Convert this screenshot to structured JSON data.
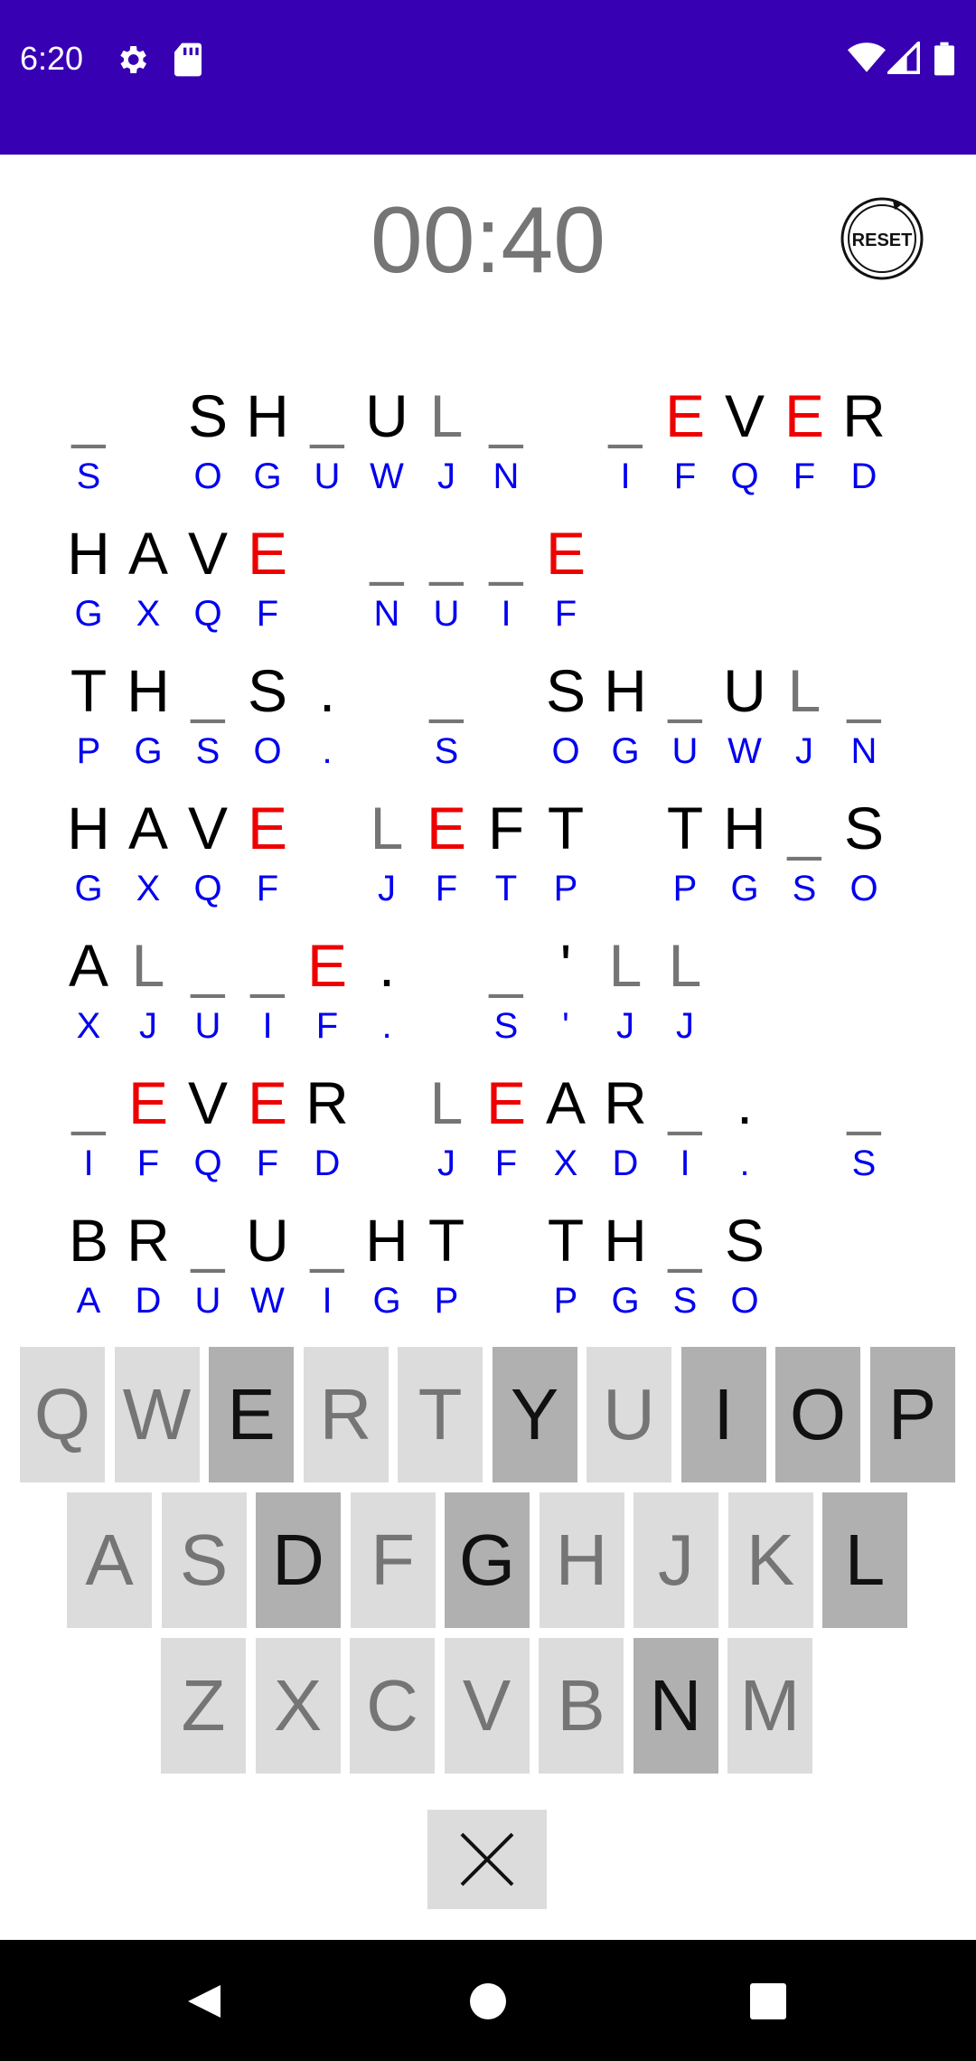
{
  "status_bar": {
    "time": "6:20",
    "left_icons": [
      "gear-icon",
      "sd-card-icon"
    ],
    "right_icons": [
      "wifi-icon",
      "signal-icon",
      "battery-icon"
    ]
  },
  "header": {
    "timer": "00:40",
    "reset_label": "RESET"
  },
  "puzzle": {
    "rows": [
      [
        {
          "col": 0,
          "top": "_",
          "bot": "S"
        },
        {
          "col": 2,
          "top": "S",
          "bot": "O"
        },
        {
          "col": 3,
          "top": "H",
          "bot": "G"
        },
        {
          "col": 4,
          "top": "_",
          "bot": "U"
        },
        {
          "col": 5,
          "top": "U",
          "bot": "W"
        },
        {
          "col": 6,
          "top": "L",
          "bot": "J",
          "state": "guess"
        },
        {
          "col": 7,
          "top": "_",
          "bot": "N"
        },
        {
          "col": 9,
          "top": "_",
          "bot": "I"
        },
        {
          "col": 10,
          "top": "E",
          "bot": "F",
          "state": "hint"
        },
        {
          "col": 11,
          "top": "V",
          "bot": "Q"
        },
        {
          "col": 12,
          "top": "E",
          "bot": "F",
          "state": "hint"
        },
        {
          "col": 13,
          "top": "R",
          "bot": "D"
        }
      ],
      [
        {
          "col": 0,
          "top": "H",
          "bot": "G"
        },
        {
          "col": 1,
          "top": "A",
          "bot": "X"
        },
        {
          "col": 2,
          "top": "V",
          "bot": "Q"
        },
        {
          "col": 3,
          "top": "E",
          "bot": "F",
          "state": "hint"
        },
        {
          "col": 5,
          "top": "_",
          "bot": "N"
        },
        {
          "col": 6,
          "top": "_",
          "bot": "U"
        },
        {
          "col": 7,
          "top": "_",
          "bot": "I"
        },
        {
          "col": 8,
          "top": "E",
          "bot": "F",
          "state": "hint"
        }
      ],
      [
        {
          "col": 0,
          "top": "T",
          "bot": "P"
        },
        {
          "col": 1,
          "top": "H",
          "bot": "G"
        },
        {
          "col": 2,
          "top": "_",
          "bot": "S"
        },
        {
          "col": 3,
          "top": "S",
          "bot": "O"
        },
        {
          "col": 4,
          "top": ".",
          "bot": "."
        },
        {
          "col": 6,
          "top": "_",
          "bot": "S"
        },
        {
          "col": 8,
          "top": "S",
          "bot": "O"
        },
        {
          "col": 9,
          "top": "H",
          "bot": "G"
        },
        {
          "col": 10,
          "top": "_",
          "bot": "U"
        },
        {
          "col": 11,
          "top": "U",
          "bot": "W"
        },
        {
          "col": 12,
          "top": "L",
          "bot": "J",
          "state": "guess"
        },
        {
          "col": 13,
          "top": "_",
          "bot": "N"
        }
      ],
      [
        {
          "col": 0,
          "top": "H",
          "bot": "G"
        },
        {
          "col": 1,
          "top": "A",
          "bot": "X"
        },
        {
          "col": 2,
          "top": "V",
          "bot": "Q"
        },
        {
          "col": 3,
          "top": "E",
          "bot": "F",
          "state": "hint"
        },
        {
          "col": 5,
          "top": "L",
          "bot": "J",
          "state": "guess"
        },
        {
          "col": 6,
          "top": "E",
          "bot": "F",
          "state": "hint"
        },
        {
          "col": 7,
          "top": "F",
          "bot": "T"
        },
        {
          "col": 8,
          "top": "T",
          "bot": "P"
        },
        {
          "col": 10,
          "top": "T",
          "bot": "P"
        },
        {
          "col": 11,
          "top": "H",
          "bot": "G"
        },
        {
          "col": 12,
          "top": "_",
          "bot": "S"
        },
        {
          "col": 13,
          "top": "S",
          "bot": "O"
        }
      ],
      [
        {
          "col": 0,
          "top": "A",
          "bot": "X"
        },
        {
          "col": 1,
          "top": "L",
          "bot": "J",
          "state": "guess"
        },
        {
          "col": 2,
          "top": "_",
          "bot": "U"
        },
        {
          "col": 3,
          "top": "_",
          "bot": "I"
        },
        {
          "col": 4,
          "top": "E",
          "bot": "F",
          "state": "hint"
        },
        {
          "col": 5,
          "top": ".",
          "bot": "."
        },
        {
          "col": 7,
          "top": "_",
          "bot": "S"
        },
        {
          "col": 8,
          "top": "'",
          "bot": "'"
        },
        {
          "col": 9,
          "top": "L",
          "bot": "J",
          "state": "guess"
        },
        {
          "col": 10,
          "top": "L",
          "bot": "J",
          "state": "guess"
        }
      ],
      [
        {
          "col": 0,
          "top": "_",
          "bot": "I"
        },
        {
          "col": 1,
          "top": "E",
          "bot": "F",
          "state": "hint"
        },
        {
          "col": 2,
          "top": "V",
          "bot": "Q"
        },
        {
          "col": 3,
          "top": "E",
          "bot": "F",
          "state": "hint"
        },
        {
          "col": 4,
          "top": "R",
          "bot": "D"
        },
        {
          "col": 6,
          "top": "L",
          "bot": "J",
          "state": "guess"
        },
        {
          "col": 7,
          "top": "E",
          "bot": "F",
          "state": "hint"
        },
        {
          "col": 8,
          "top": "A",
          "bot": "X"
        },
        {
          "col": 9,
          "top": "R",
          "bot": "D"
        },
        {
          "col": 10,
          "top": "_",
          "bot": "I"
        },
        {
          "col": 11,
          "top": ".",
          "bot": "."
        },
        {
          "col": 13,
          "top": "_",
          "bot": "S"
        }
      ],
      [
        {
          "col": 0,
          "top": "B",
          "bot": "A"
        },
        {
          "col": 1,
          "top": "R",
          "bot": "D"
        },
        {
          "col": 2,
          "top": "_",
          "bot": "U"
        },
        {
          "col": 3,
          "top": "U",
          "bot": "W"
        },
        {
          "col": 4,
          "top": "_",
          "bot": "I"
        },
        {
          "col": 5,
          "top": "H",
          "bot": "G"
        },
        {
          "col": 6,
          "top": "T",
          "bot": "P"
        },
        {
          "col": 8,
          "top": "T",
          "bot": "P"
        },
        {
          "col": 9,
          "top": "H",
          "bot": "G"
        },
        {
          "col": 10,
          "top": "_",
          "bot": "S"
        },
        {
          "col": 11,
          "top": "S",
          "bot": "O"
        }
      ]
    ]
  },
  "keyboard": {
    "rows": [
      [
        {
          "k": "Q",
          "used": false
        },
        {
          "k": "W",
          "used": false
        },
        {
          "k": "E",
          "used": true
        },
        {
          "k": "R",
          "used": false
        },
        {
          "k": "T",
          "used": false
        },
        {
          "k": "Y",
          "used": true
        },
        {
          "k": "U",
          "used": false
        },
        {
          "k": "I",
          "used": true
        },
        {
          "k": "O",
          "used": true
        },
        {
          "k": "P",
          "used": true
        }
      ],
      [
        {
          "k": "A",
          "used": false
        },
        {
          "k": "S",
          "used": false
        },
        {
          "k": "D",
          "used": true
        },
        {
          "k": "F",
          "used": false
        },
        {
          "k": "G",
          "used": true
        },
        {
          "k": "H",
          "used": false
        },
        {
          "k": "J",
          "used": false
        },
        {
          "k": "K",
          "used": false
        },
        {
          "k": "L",
          "used": true
        }
      ],
      [
        {
          "k": "Z",
          "used": false
        },
        {
          "k": "X",
          "used": false
        },
        {
          "k": "C",
          "used": false
        },
        {
          "k": "V",
          "used": false
        },
        {
          "k": "B",
          "used": false
        },
        {
          "k": "N",
          "used": true
        },
        {
          "k": "M",
          "used": false
        }
      ]
    ],
    "delete_icon": "close-icon"
  },
  "nav_bar": {
    "icons": [
      "back-icon",
      "home-icon",
      "recents-icon"
    ]
  }
}
